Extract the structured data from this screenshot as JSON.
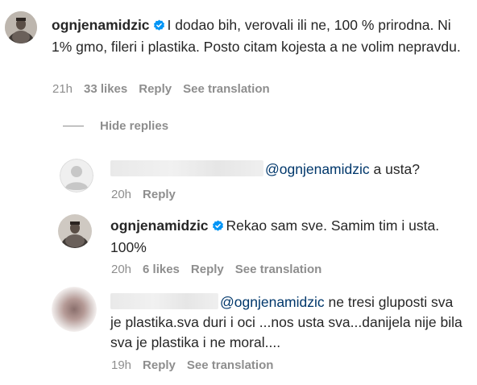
{
  "comments": [
    {
      "username": "ognjenamidzic",
      "verified": true,
      "text": "I dodao bih, verovali ili ne, 100 % prirodna. Ni 1% gmo, fileri i plastika. Posto citam kojesta a ne volim nepravdu.",
      "time": "21h",
      "likes": "33 likes",
      "reply": "Reply",
      "translate": "See translation"
    }
  ],
  "hide_replies": "Hide replies",
  "replies": [
    {
      "mention": "@ognjenamidzic",
      "text": "a usta?",
      "time": "20h",
      "reply": "Reply"
    },
    {
      "username": "ognjenamidzic",
      "verified": true,
      "text": "Rekao sam sve. Samim tim i usta. 100%",
      "time": "20h",
      "likes": "6 likes",
      "reply": "Reply",
      "translate": "See translation"
    },
    {
      "mention": "@ognjenamidzic",
      "text": "ne tresi gluposti sva je plastika.sva duri i oci ...nos usta sva...danijela nije bila sva je plastika i ne moral....",
      "time": "19h",
      "reply": "Reply",
      "translate": "See translation"
    }
  ],
  "colors": {
    "text": "#262626",
    "secondary": "#8e8e8e",
    "mention": "#00376b",
    "verified": "#0095f6"
  },
  "icons": {
    "verified": "verified-badge-icon",
    "placeholder_avatar": "default-user-icon"
  }
}
